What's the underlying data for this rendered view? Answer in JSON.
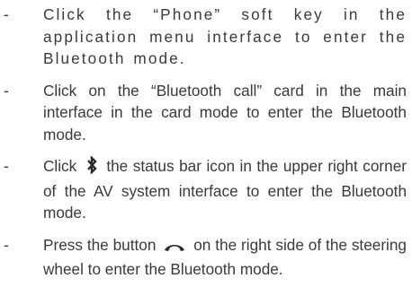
{
  "bullet_marker": "-",
  "items": [
    {
      "text": "Click the “Phone” soft key in the application menu interface to enter the Bluetooth mode."
    },
    {
      "text": "Click on the “Bluetooth call” card in the main interface in the card mode to enter the Bluetooth mode."
    },
    {
      "before": "Click",
      "icon": "bluetooth-icon",
      "after": "the status bar icon in the upper right corner of the AV system  interface to enter the Bluetooth mode."
    },
    {
      "before": "Press the button",
      "icon": "phone-handset-icon",
      "after": "on the right side of the steering wheel to enter the Bluetooth mode."
    }
  ]
}
